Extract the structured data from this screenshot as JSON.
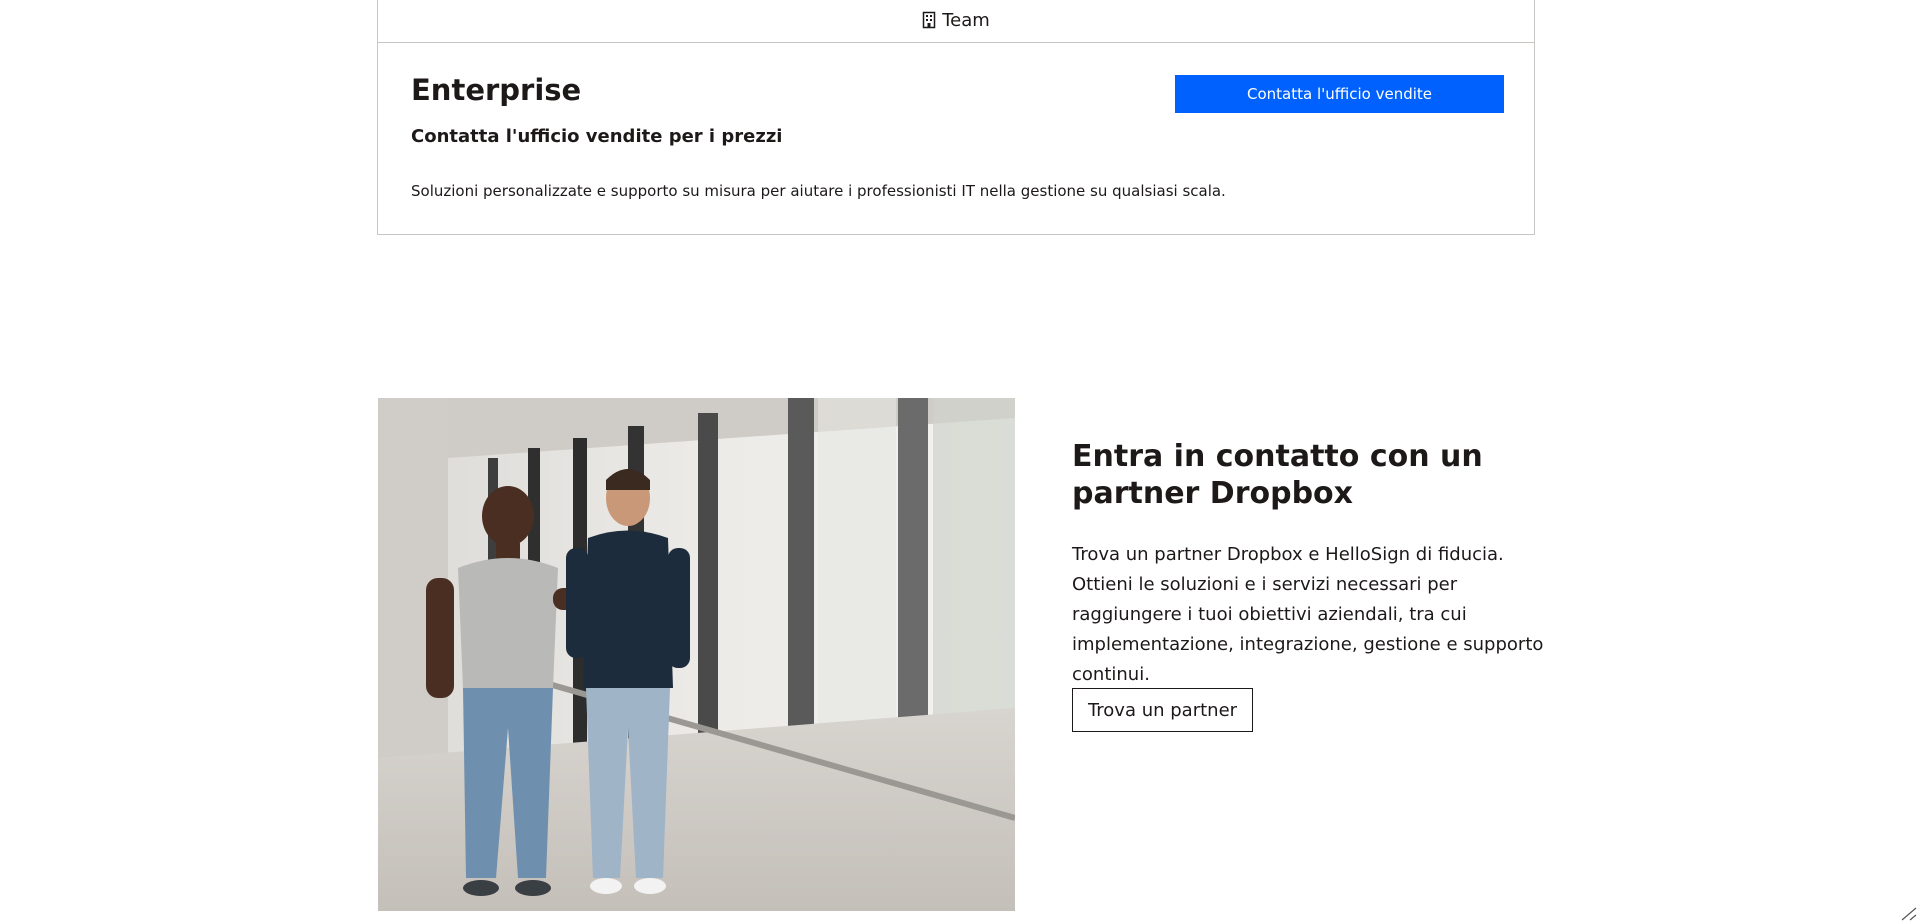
{
  "team_tab": {
    "icon": "building-icon",
    "label": "Team"
  },
  "enterprise": {
    "title": "Enterprise",
    "price_text": "Contatta l'ufficio vendite per i prezzi",
    "description": "Soluzioni personalizzate e supporto su misura per aiutare i professionisti IT nella gestione su qualsiasi scala.",
    "cta_label": "Contatta l'ufficio vendite"
  },
  "partner": {
    "image": "photo-two-men-walking-office-hallway",
    "heading": "Entra in contatto con un partner Dropbox",
    "body": "Trova un partner Dropbox e HelloSign di fiducia. Ottieni le soluzioni e i servizi necessari per raggiungere i tuoi obiettivi aziendali, tra cui implementazione, integrazione, gestione e supporto continui.",
    "cta_label": "Trova un partner"
  },
  "colors": {
    "accent": "#0061fe",
    "text": "#1e1919",
    "border": "#c9c5c2"
  }
}
